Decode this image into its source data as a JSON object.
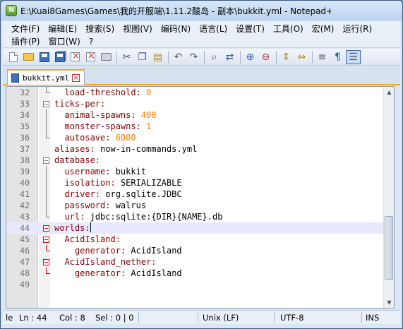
{
  "window": {
    "title": "E:\\Kuai8Games\\Games\\我的开服端\\1.11.2酸岛 - 副本\\bukkit.yml - Notepad++"
  },
  "menu": {
    "row1": [
      "文件(F)",
      "编辑(E)",
      "搜索(S)",
      "视图(V)",
      "编码(N)",
      "语言(L)",
      "设置(T)",
      "工具(O)",
      "宏(M)",
      "运行(R)"
    ],
    "row2": [
      "插件(P)",
      "窗口(W)",
      "?"
    ]
  },
  "toolbar": {
    "icons": [
      "new-file-icon",
      "open-folder-icon",
      "save-icon",
      "save-all-icon",
      "close-icon",
      "close-all-icon",
      "print-icon",
      "cut-icon",
      "copy-icon",
      "paste-icon",
      "undo-icon",
      "redo-icon",
      "find-icon",
      "replace-icon",
      "zoom-in-icon",
      "zoom-out-icon",
      "sync-vertical-icon",
      "sync-horizontal-icon",
      "word-wrap-icon",
      "show-all-chars-icon",
      "indent-guide-icon"
    ]
  },
  "tab": {
    "label": "bukkit.yml"
  },
  "editor": {
    "current_line": 44,
    "lines": [
      {
        "n": "32",
        "indent": "  ",
        "key": "load-threshold",
        "sep": ": ",
        "val": "0",
        "vtype": "n"
      },
      {
        "n": "33",
        "indent": "",
        "key": "ticks-per",
        "sep": ":",
        "val": "",
        "vtype": "v"
      },
      {
        "n": "34",
        "indent": "  ",
        "key": "animal-spawns",
        "sep": ": ",
        "val": "400",
        "vtype": "n"
      },
      {
        "n": "35",
        "indent": "  ",
        "key": "monster-spawns",
        "sep": ": ",
        "val": "1",
        "vtype": "n"
      },
      {
        "n": "36",
        "indent": "  ",
        "key": "autosave",
        "sep": ": ",
        "val": "6000",
        "vtype": "n"
      },
      {
        "n": "37",
        "indent": "",
        "key": "aliases",
        "sep": ": ",
        "val": "now-in-commands.yml",
        "vtype": "v"
      },
      {
        "n": "38",
        "indent": "",
        "key": "database",
        "sep": ":",
        "val": "",
        "vtype": "v"
      },
      {
        "n": "39",
        "indent": "  ",
        "key": "username",
        "sep": ": ",
        "val": "bukkit",
        "vtype": "v"
      },
      {
        "n": "40",
        "indent": "  ",
        "key": "isolation",
        "sep": ": ",
        "val": "SERIALIZABLE",
        "vtype": "v"
      },
      {
        "n": "41",
        "indent": "  ",
        "key": "driver",
        "sep": ": ",
        "val": "org.sqlite.JDBC",
        "vtype": "v"
      },
      {
        "n": "42",
        "indent": "  ",
        "key": "password",
        "sep": ": ",
        "val": "walrus",
        "vtype": "v"
      },
      {
        "n": "43",
        "indent": "  ",
        "key": "url",
        "sep": ": ",
        "val": "jdbc:sqlite:{DIR}{NAME}.db",
        "vtype": "v"
      },
      {
        "n": "44",
        "indent": "",
        "key": "worlds",
        "sep": ":",
        "val": "",
        "vtype": "v"
      },
      {
        "n": "45",
        "indent": "  ",
        "key": "AcidIsland",
        "sep": ":",
        "val": "",
        "vtype": "v"
      },
      {
        "n": "46",
        "indent": "    ",
        "key": "generator",
        "sep": ": ",
        "val": "AcidIsland",
        "vtype": "v"
      },
      {
        "n": "47",
        "indent": "  ",
        "key": "AcidIsland_nether",
        "sep": ":",
        "val": "",
        "vtype": "v"
      },
      {
        "n": "48",
        "indent": "    ",
        "key": "generator",
        "sep": ": ",
        "val": "AcidIsland",
        "vtype": "v"
      },
      {
        "n": "49",
        "indent": "",
        "key": "",
        "sep": "",
        "val": "",
        "vtype": "v"
      }
    ]
  },
  "status": {
    "type": "le",
    "ln": "Ln : 44",
    "col": "Col : 8",
    "sel": "Sel : 0 | 0",
    "eol": "Unix (LF)",
    "encoding": "UTF-8",
    "mode": "INS"
  }
}
